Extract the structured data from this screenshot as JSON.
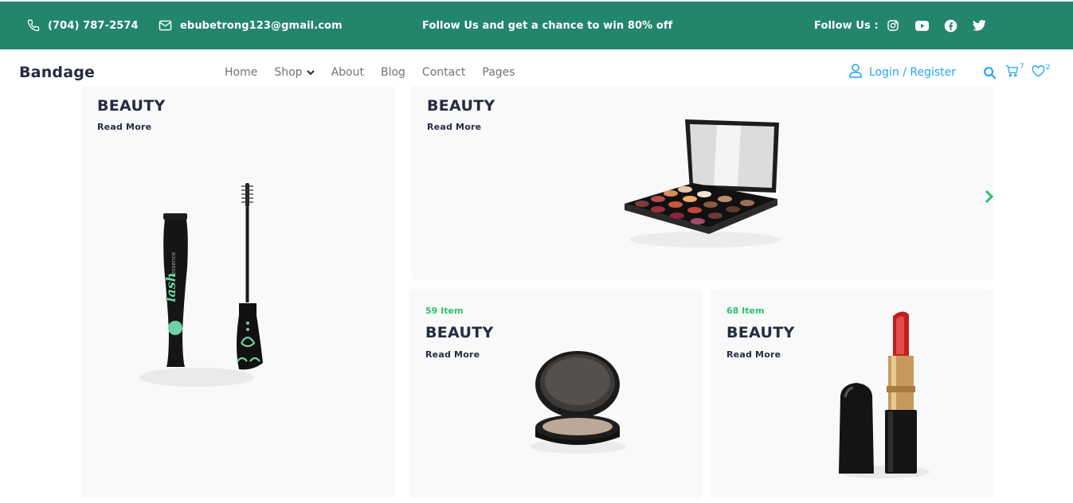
{
  "topbar": {
    "phone": "(704) 787-2574",
    "email": "ebubetrong123@gmail.com",
    "promo": "Follow Us  and get a chance to win 80% off",
    "follow_label": "Follow Us  :",
    "socials": [
      "instagram-icon",
      "youtube-icon",
      "facebook-icon",
      "twitter-icon"
    ]
  },
  "navbar": {
    "brand": "Bandage",
    "menu": [
      "Home",
      "Shop",
      "About",
      "Blog",
      "Contact",
      "Pages"
    ],
    "login": "Login / Register",
    "cart_count": "7",
    "wishlist_count": "2"
  },
  "cards": {
    "main": {
      "title": "BEAUTY",
      "more": "Read More"
    },
    "top": {
      "title": "BEAUTY",
      "more": "Read More"
    },
    "b1": {
      "items": "59 Item",
      "title": "BEAUTY",
      "more": "Read More"
    },
    "b2": {
      "items": "68 Item",
      "title": "BEAUTY",
      "more": "Read More"
    }
  },
  "colors": {
    "topbar": "#23856d",
    "accent": "#23a6f0",
    "success": "#2dc071",
    "text": "#252b42",
    "muted": "#737373",
    "card_bg": "#f9f9f9"
  }
}
